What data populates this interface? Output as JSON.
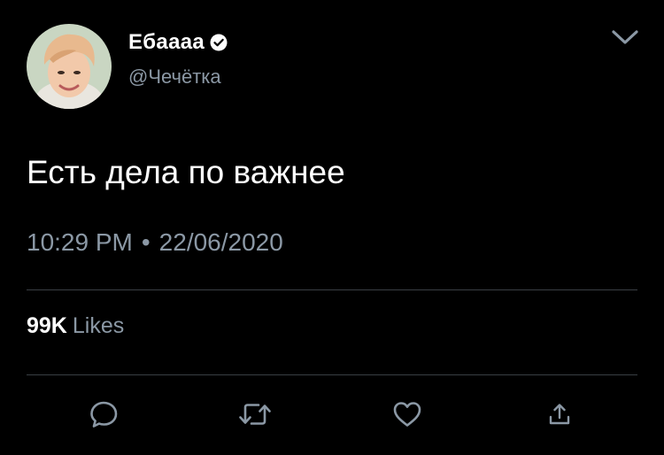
{
  "author": {
    "display_name": "Ебаааа",
    "handle": "@Чечётка",
    "verified": true
  },
  "tweet": {
    "text": "Есть дела по важнее",
    "time": "10:29 PM",
    "separator": "•",
    "date": "22/06/2020"
  },
  "stats": {
    "likes_count": "99K",
    "likes_label": "Likes"
  },
  "icons": {
    "menu": "chevron-down-icon",
    "reply": "reply-icon",
    "retweet": "retweet-icon",
    "like": "heart-icon",
    "share": "share-icon",
    "verified": "verified-badge-icon"
  },
  "colors": {
    "background": "#000000",
    "primary_text": "#ffffff",
    "secondary_text": "#8b98a5",
    "divider": "#3a3f44"
  }
}
